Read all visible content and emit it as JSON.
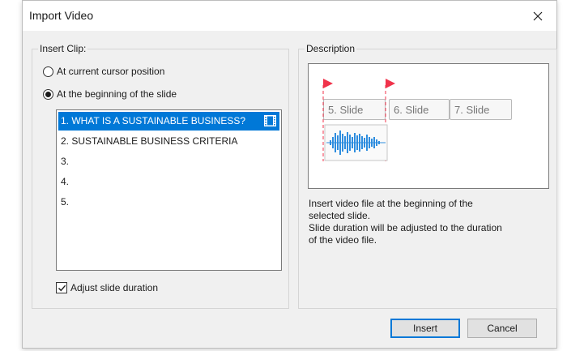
{
  "window": {
    "title": "Import Video"
  },
  "insert_clip": {
    "label": "Insert Clip:",
    "options": [
      {
        "label": "At current cursor position",
        "selected": false
      },
      {
        "label": "At the beginning of the slide",
        "selected": true
      }
    ],
    "slides": [
      {
        "label": "1. WHAT IS A SUSTAINABLE BUSINESS?",
        "selected": true,
        "icon": "film-icon"
      },
      {
        "label": "2. SUSTAINABLE BUSINESS CRITERIA",
        "selected": false
      },
      {
        "label": "3.",
        "selected": false
      },
      {
        "label": "4.",
        "selected": false
      },
      {
        "label": "5.",
        "selected": false
      }
    ],
    "adjust_label": "Adjust slide duration",
    "adjust_checked": true
  },
  "description": {
    "label": "Description",
    "preview_slides": [
      "5. Slide",
      "6. Slide",
      "7. Slide"
    ],
    "text": "Insert video file at the beginning of the selected slide.\nSlide duration will be adjusted to the duration of the video file."
  },
  "buttons": {
    "insert": "Insert",
    "cancel": "Cancel"
  },
  "colors": {
    "accent": "#0078d7",
    "marker": "#f0334b",
    "waveform": "#2e8ddf"
  }
}
